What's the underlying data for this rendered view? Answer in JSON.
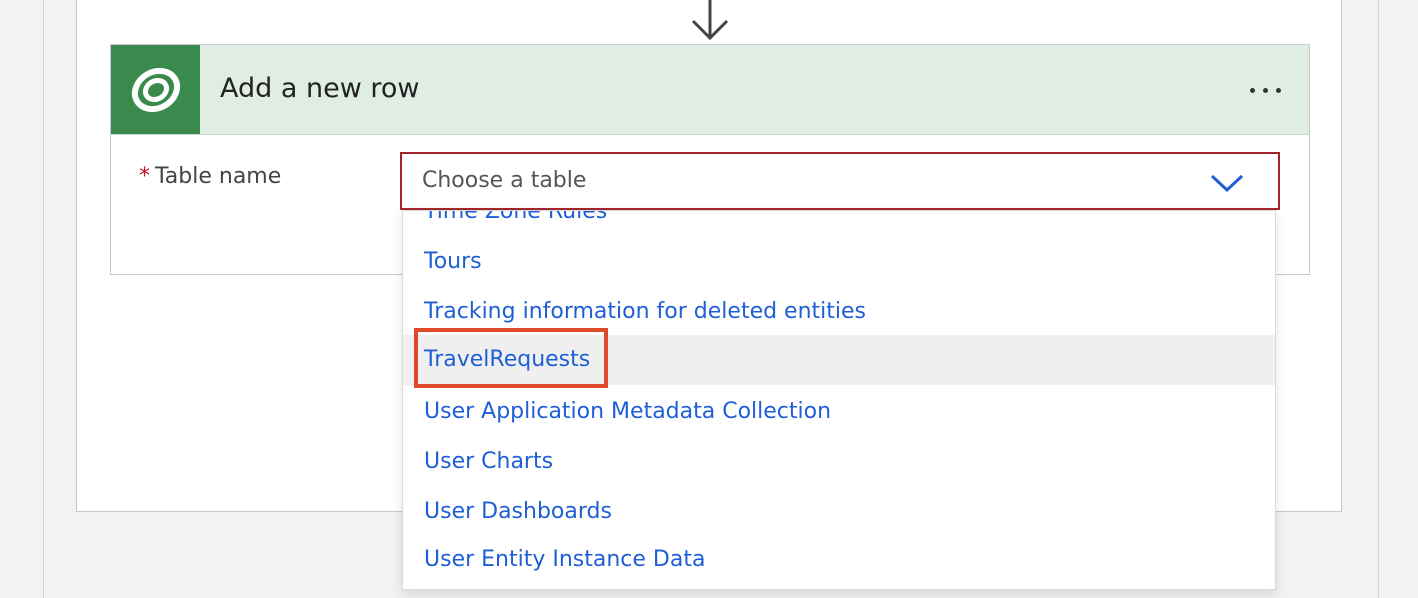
{
  "action_card": {
    "title": "Add a new row",
    "icon": "dataverse-icon",
    "accent_color": "#3a8a4d",
    "header_color": "#dfede3"
  },
  "form": {
    "table_name_label": "Table name",
    "required_marker": "*",
    "table_select_placeholder": "Choose a table"
  },
  "dropdown": {
    "options": [
      "Time Zone Rules",
      "Tours",
      "Tracking information for deleted entities",
      "TravelRequests",
      "User Application Metadata Collection",
      "User Charts",
      "User Dashboards",
      "User Entity Instance Data"
    ],
    "hovered_option": "TravelRequests",
    "option_text_color": "#1f5fd6",
    "annotation_color": "#e04a2c"
  }
}
